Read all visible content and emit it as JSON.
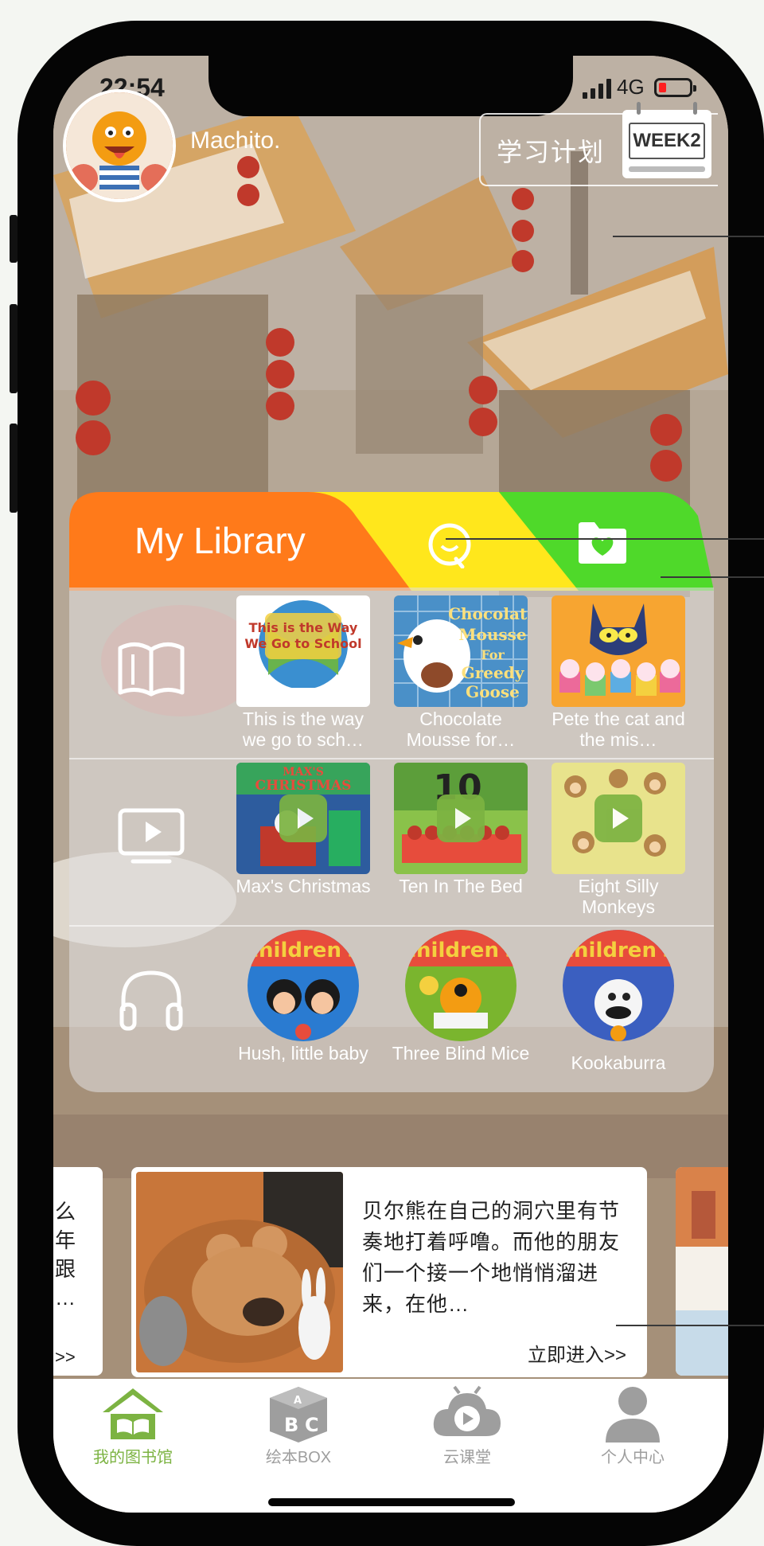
{
  "status_bar": {
    "time": "22:54",
    "network": "4G"
  },
  "header": {
    "username": "Machito.",
    "plan_label": "学习计划",
    "week_badge": "WEEK2"
  },
  "library": {
    "title": "My Library",
    "tabs": [
      {
        "name": "library",
        "color": "#ff7a1a"
      },
      {
        "name": "search",
        "icon": "search-icon",
        "color": "#ffe71c"
      },
      {
        "name": "favorites",
        "icon": "folder-heart-icon",
        "color": "#4fd92a"
      }
    ],
    "rows": [
      {
        "type": "books",
        "icon": "book-icon",
        "items": [
          {
            "title": "This is the way we go to sch…"
          },
          {
            "title": "Chocolate Mousse for…"
          },
          {
            "title": "Pete the cat and the mis…"
          }
        ]
      },
      {
        "type": "videos",
        "icon": "tv-play-icon",
        "items": [
          {
            "title": "Max's Christmas"
          },
          {
            "title": "Ten In The Bed"
          },
          {
            "title": "Eight Silly Monkeys"
          }
        ]
      },
      {
        "type": "audio",
        "icon": "headphones-icon",
        "items": [
          {
            "title": "Hush, little baby"
          },
          {
            "title": "Three Blind Mice"
          },
          {
            "title": "Kookaburra"
          }
        ]
      }
    ]
  },
  "carousel": {
    "left_card": {
      "text": "么\n年\n跟\n…",
      "more": ">>"
    },
    "main_card": {
      "description": "贝尔熊在自己的洞穴里有节奏地打着呼噜。而他的朋友们一个接一个地悄悄溜进来，在他…",
      "more": "立即进入>>"
    }
  },
  "tabbar": [
    {
      "label": "我的图书馆",
      "icon": "library-home-icon",
      "active": true
    },
    {
      "label": "绘本BOX",
      "icon": "abc-blocks-icon",
      "active": false
    },
    {
      "label": "云课堂",
      "icon": "cloud-tv-icon",
      "active": false
    },
    {
      "label": "个人中心",
      "icon": "user-icon",
      "active": false
    }
  ],
  "colors": {
    "accent_green": "#7cb342",
    "library_orange": "#ff7a1a",
    "tab_yellow": "#ffe71c",
    "tab_green": "#4fd92a"
  }
}
